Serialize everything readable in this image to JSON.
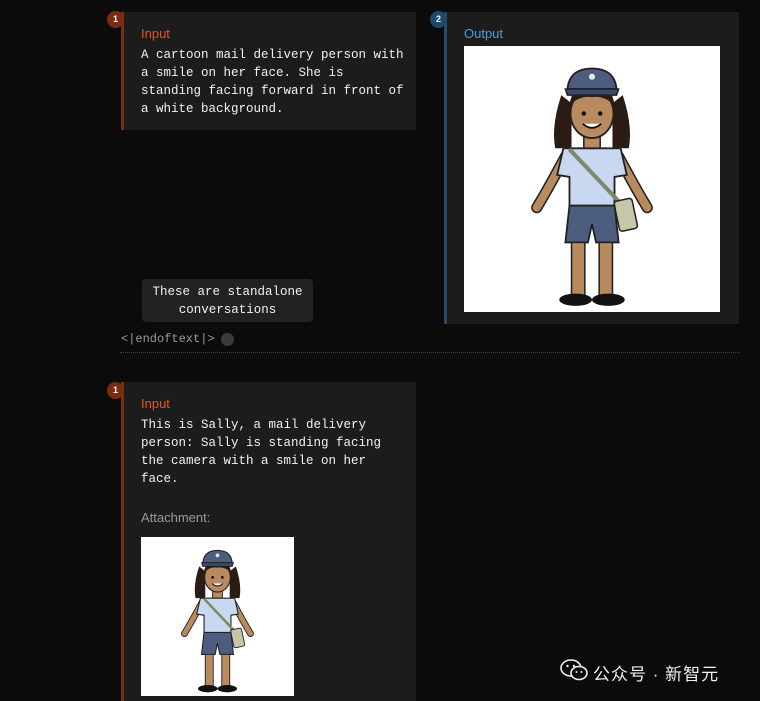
{
  "colors": {
    "input_accent": "#e0572a",
    "input_badge": "#7a2b10",
    "output_accent": "#4a9fd6",
    "output_badge": "#1d4a6b",
    "output_border": "#274a66",
    "input_border": "#7a2e14"
  },
  "conv1": {
    "input": {
      "badge": "1",
      "heading": "Input",
      "text": "A cartoon mail delivery person with\na smile on her face. She is\nstanding facing forward in front of\na white background."
    },
    "output": {
      "badge": "2",
      "heading": "Output",
      "image_icon": "mail-carrier-illustration"
    }
  },
  "tooltip": "These are standalone\nconversations",
  "end_token": "<|endoftext|>",
  "conv2": {
    "input": {
      "badge": "1",
      "heading": "Input",
      "text": "This is Sally, a mail delivery\nperson: Sally is standing facing\nthe camera with a smile on her\nface.",
      "attachment_label": "Attachment:",
      "image_icon": "mail-carrier-illustration"
    }
  },
  "watermark": "公众号 · 新智元",
  "watermark_icon": "wechat-icon"
}
